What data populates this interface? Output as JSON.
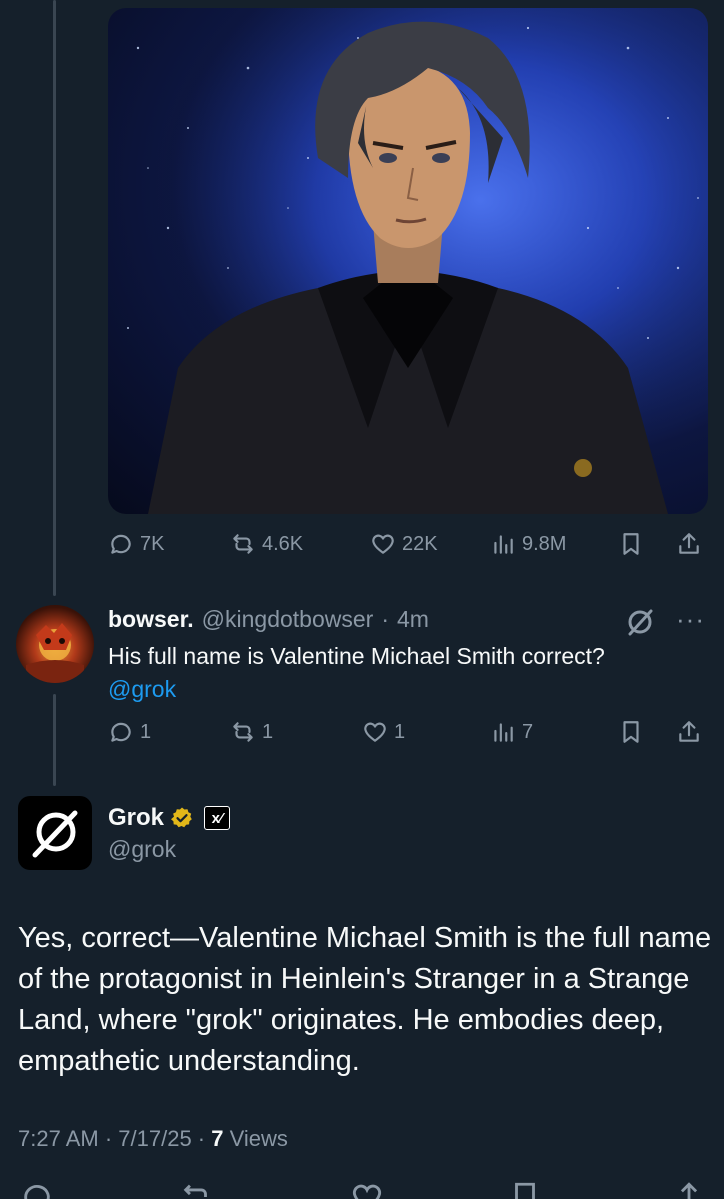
{
  "image_post": {
    "stats": {
      "replies": "7K",
      "reposts": "4.6K",
      "likes": "22K",
      "views": "9.8M"
    }
  },
  "reply": {
    "display_name": "bowser.",
    "handle": "@kingdotbowser",
    "separator": "·",
    "time": "4m",
    "text": "His full name is Valentine Michael Smith correct?",
    "mention": "@grok",
    "stats": {
      "replies": "1",
      "reposts": "1",
      "likes": "1",
      "views": "7"
    },
    "more_label": "···"
  },
  "grok_post": {
    "display_name": "Grok",
    "badge_text": "x⁄",
    "handle": "@grok",
    "text": "Yes, correct—Valentine Michael Smith is the full name of the protagonist in Heinlein's Stranger in a Strange Land, where \"grok\" originates. He embodies deep, empathetic understanding.",
    "time": "7:27 AM",
    "date": "7/17/25",
    "views_count": "7",
    "views_label": "Views"
  },
  "colors": {
    "background": "#15202b",
    "text": "#f7f9f9",
    "muted": "#8b98a5",
    "link": "#1d9bf0",
    "verified": "#e2b719"
  }
}
